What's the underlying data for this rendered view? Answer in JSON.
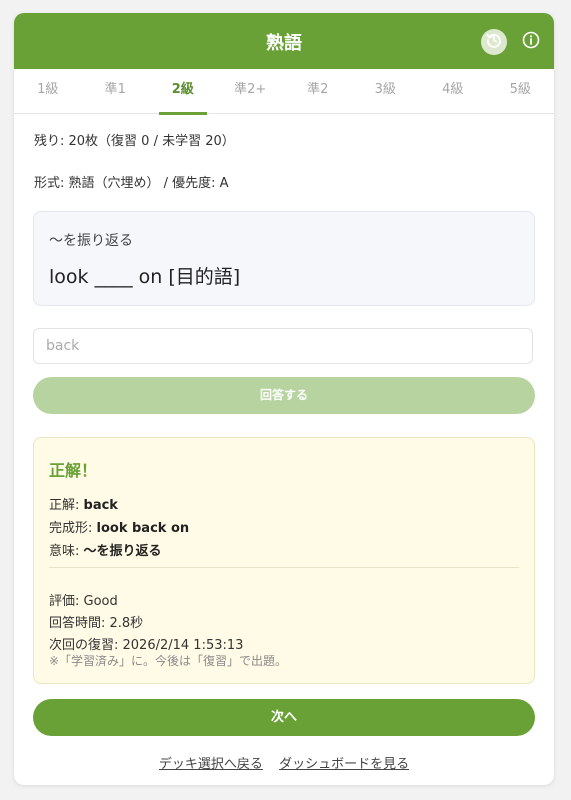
{
  "header": {
    "title": "熟語",
    "history_icon": "history-icon",
    "info_icon": "info-icon",
    "accent_color": "#6aa136"
  },
  "tabs": [
    {
      "label": "1級",
      "active": false
    },
    {
      "label": "準1",
      "active": false
    },
    {
      "label": "2級",
      "active": true
    },
    {
      "label": "準2+",
      "active": false
    },
    {
      "label": "準2",
      "active": false
    },
    {
      "label": "3級",
      "active": false
    },
    {
      "label": "4級",
      "active": false
    },
    {
      "label": "5級",
      "active": false
    }
  ],
  "status": {
    "remaining": "残り: 20枚（復習 0 / 未学習 20）",
    "format": "形式: 熟語（穴埋め） / 優先度: A"
  },
  "prompt": {
    "meaning": "〜を振り返る",
    "phrase": "look ____ on [目的語]"
  },
  "answer": {
    "value": "back",
    "submit_label": "回答する"
  },
  "result": {
    "title": "正解！",
    "correct_label": "正解: ",
    "correct_value": "back",
    "complete_label": "完成形: ",
    "complete_value": "look back on",
    "meaning_label": "意味: ",
    "meaning_value": "〜を振り返る",
    "rating": "評価: Good",
    "answer_time": "回答時間: 2.8秒",
    "next_review": "次回の復習: 2026/2/14 1:53:13",
    "note": "※「学習済み」に。今後は「復習」で出題。"
  },
  "actions": {
    "next_label": "次へ",
    "back_to_deck": "デッキ選択へ戻る",
    "view_dashboard": "ダッシュボードを見る"
  }
}
